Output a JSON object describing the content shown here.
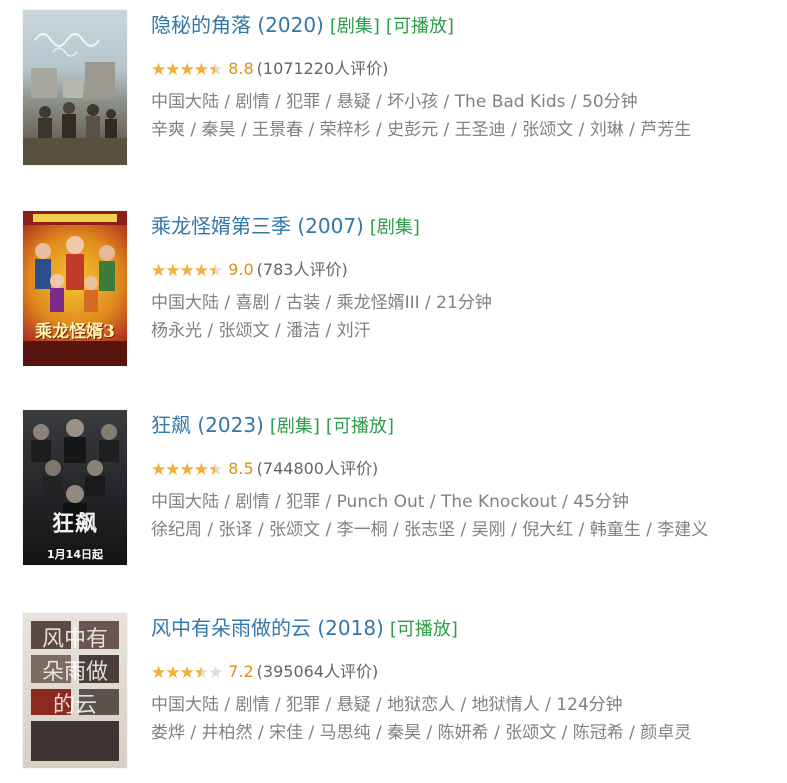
{
  "colors": {
    "link": "#3377aa",
    "tag": "#2d9d4a",
    "star": "#f3b037",
    "score": "#e09015",
    "meta": "#818181"
  },
  "items": [
    {
      "title": "隐秘的角落 (2020)",
      "tags": [
        "[剧集]",
        "[可播放]"
      ],
      "rating": 8.8,
      "score_text": "8.8",
      "votes": "(1071220人评价)",
      "meta": "中国大陆 / 剧情 / 犯罪 / 悬疑 / 坏小孩 / The Bad Kids / 50分钟",
      "cast": "辛爽 / 秦昊 / 王景春 / 荣梓杉 / 史彭元 / 王圣迪 / 张颂文 / 刘琳 / 芦芳生",
      "poster_text": "",
      "poster_icon": "poster-drama-icon"
    },
    {
      "title": "乘龙怪婿第三季 (2007)",
      "tags": [
        "[剧集]"
      ],
      "rating": 9.0,
      "score_text": "9.0",
      "votes": "(783人评价)",
      "meta": "中国大陆 / 喜剧 / 古装 / 乘龙怪婿III / 21分钟",
      "cast": "杨永光 / 张颂文 / 潘洁 / 刘汗",
      "poster_text": "乘龙怪婿3",
      "poster_icon": "poster-comedy-icon"
    },
    {
      "title": "狂飙 (2023)",
      "tags": [
        "[剧集]",
        "[可播放]"
      ],
      "rating": 8.5,
      "score_text": "8.5",
      "votes": "(744800人评价)",
      "meta": "中国大陆 / 剧情 / 犯罪 / Punch Out / The Knockout / 45分钟",
      "cast": "徐纪周 / 张译 / 张颂文 / 李一桐 / 张志坚 / 吴刚 / 倪大红 / 韩童生 / 李建义",
      "poster_text": "狂飙",
      "poster_sub": "1月14日起",
      "poster_icon": "poster-crime-icon"
    },
    {
      "title": "风中有朵雨做的云 (2018)",
      "tags": [
        "[可播放]"
      ],
      "rating": 7.2,
      "score_text": "7.2",
      "votes": "(395064人评价)",
      "meta": "中国大陆 / 剧情 / 犯罪 / 悬疑 / 地狱恋人 / 地狱情人 / 124分钟",
      "cast": "娄烨 / 井柏然 / 宋佳 / 马思纯 / 秦昊 / 陈妍希 / 张颂文 / 陈冠希 / 颜卓灵",
      "poster_text": "风中有朵雨做的云",
      "poster_icon": "poster-film-icon"
    }
  ]
}
